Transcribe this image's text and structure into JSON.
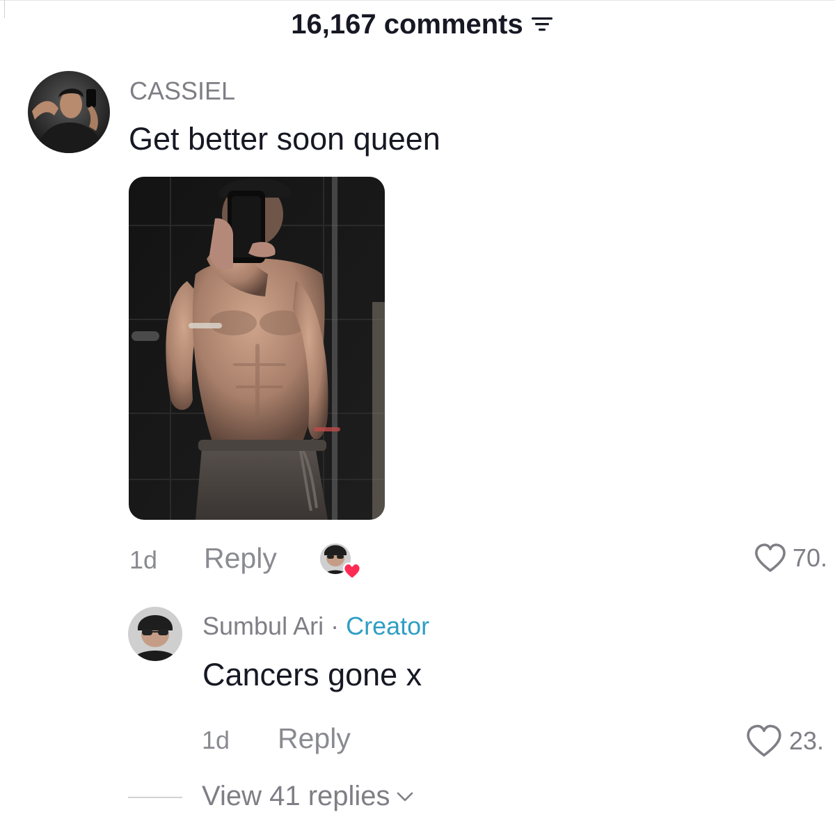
{
  "header": {
    "title": "16,167 comments"
  },
  "comment": {
    "username": "CASSIEL",
    "text": "Get better soon queen",
    "time": "1d",
    "reply_label": "Reply",
    "like_count": "70."
  },
  "reply": {
    "username": "Sumbul Ari",
    "separator": "·",
    "badge": "Creator",
    "text": "Cancers gone x",
    "time": "1d",
    "reply_label": "Reply",
    "like_count": "23."
  },
  "view_replies": {
    "label": "View 41 replies"
  },
  "colors": {
    "creator_badge": "#2f9ec4",
    "liked_heart": "#fe2c55",
    "muted_text": "#7e7e85"
  },
  "icons": {
    "filter": "filter-icon",
    "like": "heart-outline-icon",
    "creator_liked": "creator-liked-heart-icon",
    "expand": "chevron-down-icon"
  }
}
